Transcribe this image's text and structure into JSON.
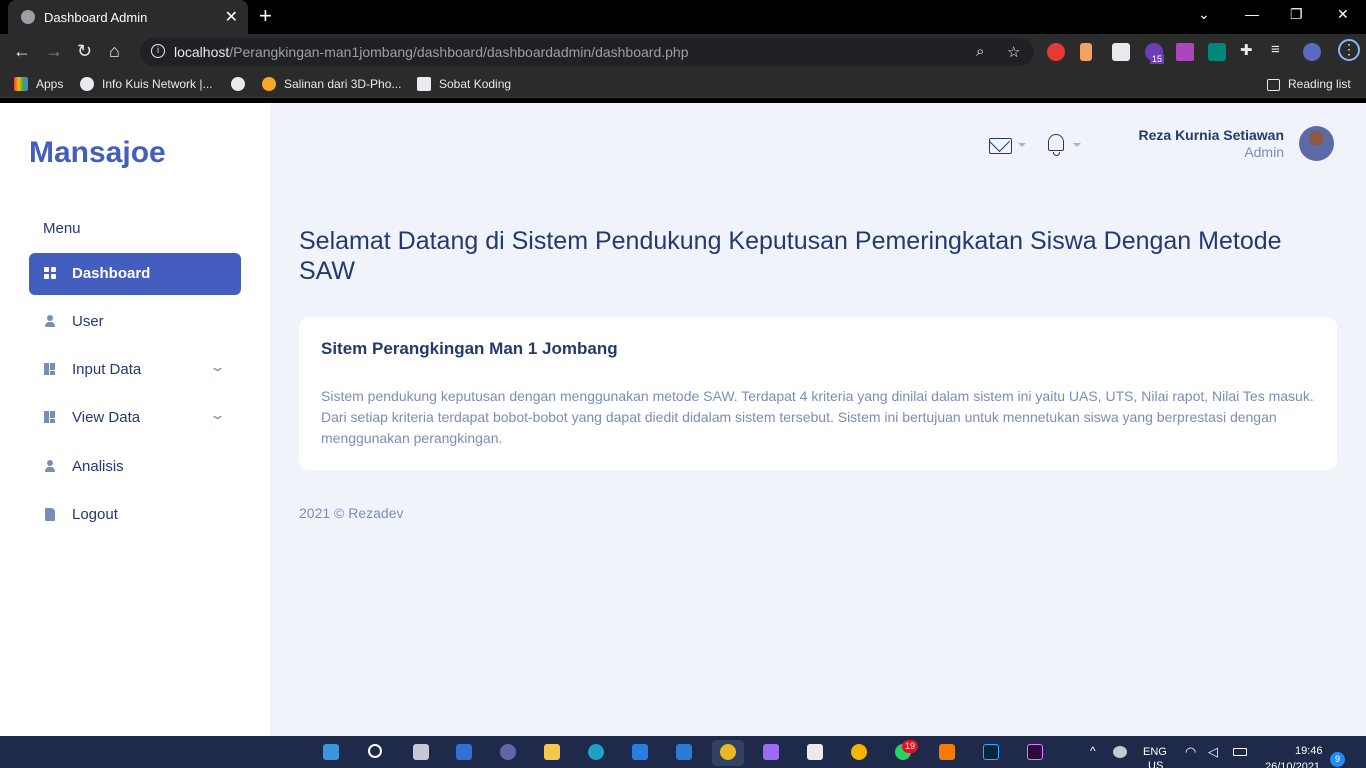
{
  "browser": {
    "tab_title": "Dashboard Admin",
    "tab_close": "✕",
    "new_tab": "+",
    "window_controls": [
      "⌄",
      "—",
      "❐",
      "✕"
    ],
    "url_host": "localhost",
    "url_path": "/Perangkingan-man1jombang/dashboard/dashboardadmin/dashboard.php",
    "bookmarks": [
      "Apps",
      "Info Kuis Network |...",
      "",
      "Salinan dari 3D-Pho...",
      "Sobat Koding"
    ],
    "reading_list": "Reading list",
    "extension_badge": "15"
  },
  "sidebar": {
    "brand": "Mansajoe",
    "menu_title": "Menu",
    "items": [
      {
        "label": "Dashboard",
        "icon": "dashboard-icon",
        "active": true
      },
      {
        "label": "User",
        "icon": "user-icon"
      },
      {
        "label": "Input Data",
        "icon": "grid-icon",
        "has_submenu": true
      },
      {
        "label": "View Data",
        "icon": "grid-icon",
        "has_submenu": true
      },
      {
        "label": "Analisis",
        "icon": "user-icon"
      },
      {
        "label": "Logout",
        "icon": "file-icon"
      }
    ]
  },
  "header": {
    "user_name": "Reza Kurnia Setiawan",
    "user_role": "Admin"
  },
  "main": {
    "title": "Selamat Datang di Sistem Pendukung Keputusan Pemeringkatan Siswa Dengan Metode SAW",
    "card_title": "Sitem Perangkingan Man 1 Jombang",
    "card_body": "Sistem pendukung keputusan dengan menggunakan metode SAW. Terdapat 4 kriteria yang dinilai dalam sistem ini yaitu UAS, UTS, Nilai rapot, Nilai Tes masuk. Dari setiap kriteria terdapat bobot-bobot yang dapat diedit didalam sistem tersebut. Sistem ini bertujuan untuk mennetukan siswa yang berprestasi dengan menggunakan perangkingan.",
    "footer": "2021 © Rezadev"
  },
  "taskbar": {
    "notification_badge": "19",
    "language": "ENG",
    "language_sub": "US",
    "time": "19:46",
    "date": "26/10/2021",
    "notification_count": "9"
  },
  "colors": {
    "primary": "#435ebe",
    "heading": "#25396f",
    "muted": "#7c8db5",
    "page_bg": "#f0f4fa"
  }
}
